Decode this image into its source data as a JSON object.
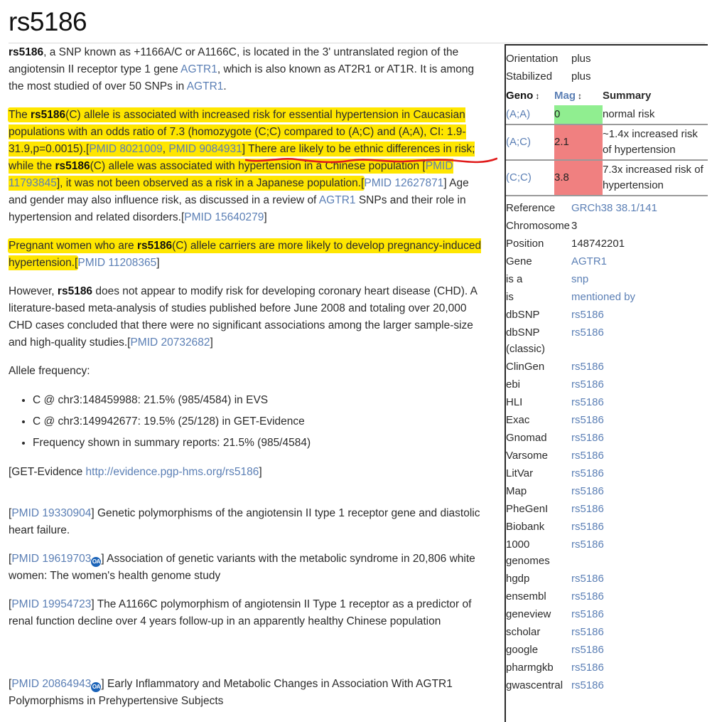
{
  "page": {
    "title": "rs5186"
  },
  "article": {
    "intro": {
      "lead": "rs5186",
      "text_1": ", a SNP known as +1166A/C or A1166C, is located in the 3' untranslated region of the angiotensin II receptor type 1 gene ",
      "gene_link_1": "AGTR1",
      "text_2": ", which is also known as AT2R1 or AT1R. It is among the most studied of over 50 SNPs in ",
      "gene_link_2": "AGTR1",
      "text_3": "."
    },
    "hypertension_para": {
      "s1": "The ",
      "s1_bold": "rs5186",
      "s2": "(C) allele is associated with increased risk for essential hypertension in Caucasian populations with an odds ratio of 7.3 (homozygote (C;C) compared to (A;C) and (A;A), CI: 1.9-31.9,p=0.0015).[",
      "pmid_1": "PMID 8021009",
      "s3": ", ",
      "pmid_2": "PMID 9084931",
      "s4": "] There are likely to be ethnic differences in risk; while the ",
      "s4_bold": "rs5186",
      "s5": "(C) allele was associated with hypertension in a Chinese population [",
      "pmid_3": "PMID 11793845",
      "s6": "], it was not been observed as a risk in a Japanese population.[",
      "pmid_4": "PMID 12627871",
      "s7": "] Age and gender may also influence risk, as discussed in a review of ",
      "gene_link": "AGTR1",
      "s8": " SNPs and their role in hypertension and related disorders.[",
      "pmid_5": "PMID 15640279",
      "s9": "]"
    },
    "pregnancy_para": {
      "s1": "Pregnant women who are ",
      "s1_bold": "rs5186",
      "s2": "(C) allele carriers are more likely to develop pregnancy-induced hypertension.[",
      "pmid": "PMID 11208365",
      "s3": "]"
    },
    "chd_para": {
      "s1": "However, ",
      "s1_bold": "rs5186",
      "s2": " does not appear to modify risk for developing coronary heart disease (CHD). A literature-based meta-analysis of studies published before June 2008 and totaling over 20,000 CHD cases concluded that there were no significant associations among the larger sample-size and high-quality studies.[",
      "pmid": "PMID 20732682",
      "s3": "]"
    },
    "allele_frequency": {
      "heading": "Allele frequency:",
      "items": [
        "C @ chr3:148459988: 21.5% (985/4584) in EVS",
        "C @ chr3:149942677: 19.5% (25/128) in GET-Evidence",
        "Frequency shown in summary reports: 21.5% (985/4584)"
      ],
      "get_evidence_prefix": "[GET-Evidence ",
      "get_evidence_url": "http://evidence.pgp-hms.org/rs5186",
      "get_evidence_suffix": "]"
    },
    "references": [
      {
        "pmid_prefix": "[",
        "pmid": "PMID 19330904",
        "oa": false,
        "pmid_suffix": "] ",
        "title": "Genetic polymorphisms of the angiotensin II type 1 receptor gene and diastolic heart failure."
      },
      {
        "pmid_prefix": "[",
        "pmid": "PMID 19619703",
        "oa": true,
        "oa_label": "OA",
        "pmid_suffix": "] ",
        "title": "Association of genetic variants with the metabolic syndrome in 20,806 white women: The women's health genome study"
      },
      {
        "pmid_prefix": "[",
        "pmid": "PMID 19954723",
        "oa": false,
        "pmid_suffix": "] ",
        "title": "The A1166C polymorphism of angiotensin II Type 1 receptor as a predictor of renal function decline over 4 years follow-up in an apparently healthy Chinese population"
      },
      {
        "pmid_prefix": "[",
        "pmid": "PMID 20864943",
        "oa": true,
        "oa_label": "OA",
        "pmid_suffix": "] ",
        "title": "Early Inflammatory and Metabolic Changes in Association With AGTR1 Polymorphisms in Prehypertensive Subjects"
      }
    ]
  },
  "infobox": {
    "orientation": {
      "key": "Orientation",
      "value": "plus"
    },
    "stabilized": {
      "key": "Stabilized",
      "value": "plus"
    },
    "geno_table": {
      "headers": {
        "geno": "Geno",
        "mag": "Mag",
        "summary": "Summary"
      },
      "sort_glyph": "↕",
      "rows": [
        {
          "geno": "(A;A)",
          "mag": "0",
          "mag_color": "#90ee90",
          "summary": "normal risk"
        },
        {
          "geno": "(A;C)",
          "mag": "2.1",
          "mag_color": "#f08080",
          "summary": "~1.4x increased risk of hypertension"
        },
        {
          "geno": "(C;C)",
          "mag": "3.8",
          "mag_color": "#f08080",
          "summary": "7.3x increased risk of hypertension"
        }
      ]
    },
    "properties": [
      {
        "key": "Reference",
        "key_link": true,
        "value": "GRCh38 38.1/141",
        "value_link": true
      },
      {
        "key": "Chromosome",
        "key_link": true,
        "value": "3",
        "value_link": false
      },
      {
        "key": "Position",
        "key_link": true,
        "value": "148742201",
        "value_link": false
      },
      {
        "key": "Gene",
        "key_link": true,
        "value": "AGTR1",
        "value_link": true
      },
      {
        "key": "is a",
        "key_link": false,
        "value": "snp",
        "value_link": true
      },
      {
        "key": "is",
        "key_link": false,
        "value": "mentioned by",
        "value_link": true
      },
      {
        "key": "dbSNP",
        "key_link": false,
        "value": "rs5186",
        "value_link": true
      },
      {
        "key": "dbSNP (classic)",
        "key_link": false,
        "value": "rs5186",
        "value_link": true
      },
      {
        "key": "ClinGen",
        "key_link": false,
        "value": "rs5186",
        "value_link": true
      },
      {
        "key": "ebi",
        "key_link": false,
        "value": "rs5186",
        "value_link": true
      },
      {
        "key": "HLI",
        "key_link": false,
        "value": "rs5186",
        "value_link": true
      },
      {
        "key": "Exac",
        "key_link": false,
        "value": "rs5186",
        "value_link": true
      },
      {
        "key": "Gnomad",
        "key_link": false,
        "value": "rs5186",
        "value_link": true
      },
      {
        "key": "Varsome",
        "key_link": false,
        "value": "rs5186",
        "value_link": true
      },
      {
        "key": "LitVar",
        "key_link": false,
        "value": "rs5186",
        "value_link": true
      },
      {
        "key": "Map",
        "key_link": false,
        "value": "rs5186",
        "value_link": true
      },
      {
        "key": "PheGenI",
        "key_link": false,
        "value": "rs5186",
        "value_link": true
      },
      {
        "key": "Biobank",
        "key_link": false,
        "value": "rs5186",
        "value_link": true
      },
      {
        "key": "1000 genomes",
        "key_link": true,
        "value": "rs5186",
        "value_link": true
      },
      {
        "key": "hgdp",
        "key_link": false,
        "value": "rs5186",
        "value_link": true
      },
      {
        "key": "ensembl",
        "key_link": false,
        "value": "rs5186",
        "value_link": true
      },
      {
        "key": "geneview",
        "key_link": false,
        "value": "rs5186",
        "value_link": true
      },
      {
        "key": "scholar",
        "key_link": false,
        "value": "rs5186",
        "value_link": true
      },
      {
        "key": "google",
        "key_link": false,
        "value": "rs5186",
        "value_link": true
      },
      {
        "key": "pharmgkb",
        "key_link": false,
        "value": "rs5186",
        "value_link": true
      },
      {
        "key": "gwascentral",
        "key_link": false,
        "value": "rs5186",
        "value_link": true
      }
    ]
  },
  "annotations": {
    "highlight_color": "#ffe600",
    "underline_color": "#e01b1b",
    "link_color": "#5b7fb5"
  }
}
